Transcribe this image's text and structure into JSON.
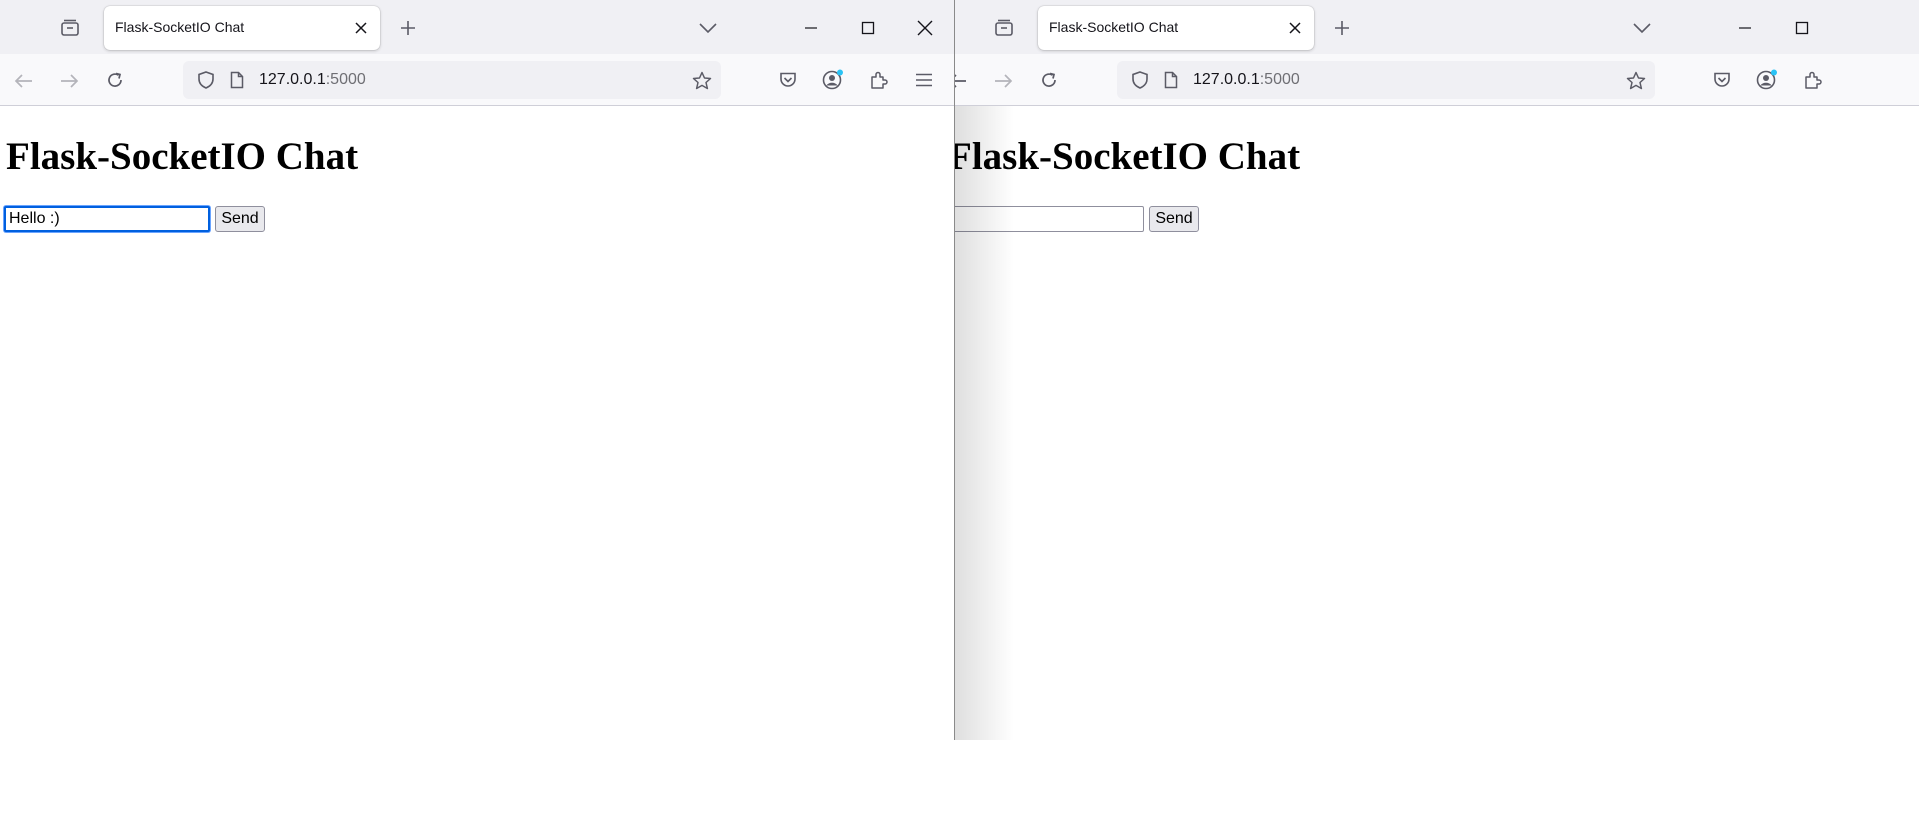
{
  "windows": [
    {
      "tab_title": "Flask-SocketIO Chat",
      "url_host": "127.0.0.1",
      "url_port": ":5000",
      "page_heading": "Flask-SocketIO Chat",
      "message_input_value": "Hello :)",
      "send_label": "Send"
    },
    {
      "tab_title": "Flask-SocketIO Chat",
      "url_host": "127.0.0.1",
      "url_port": ":5000",
      "page_heading": "Flask-SocketIO Chat",
      "message_input_value": "",
      "send_label": "Send"
    }
  ],
  "colors": {
    "tab_strip": "#f0f0f4",
    "toolbar": "#f9f9fb",
    "focus_ring": "#0060df",
    "notification_dot": "#2ac3f5"
  },
  "icons": [
    "firefox-view-icon",
    "new-tab-icon",
    "list-all-tabs-icon",
    "minimize-icon",
    "maximize-icon",
    "close-window-icon",
    "back-icon",
    "forward-icon",
    "reload-icon",
    "tracking-protection-icon",
    "page-info-icon",
    "bookmark-star-icon",
    "pocket-icon",
    "account-icon",
    "extensions-icon",
    "app-menu-icon",
    "close-tab-icon"
  ]
}
